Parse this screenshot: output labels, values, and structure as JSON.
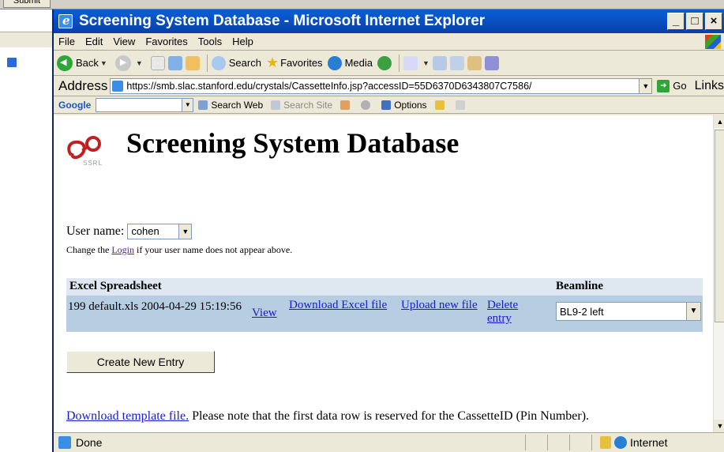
{
  "background": {
    "submit_label": "Submit"
  },
  "window": {
    "title": "Screening System Database - Microsoft Internet Explorer",
    "minimize": "_",
    "maximize": "□",
    "close": "×"
  },
  "menu": [
    "File",
    "Edit",
    "View",
    "Favorites",
    "Tools",
    "Help"
  ],
  "toolbar": {
    "back": "Back",
    "search": "Search",
    "favorites": "Favorites",
    "media": "Media"
  },
  "address": {
    "label": "Address",
    "url": "https://smb.slac.stanford.edu/crystals/CassetteInfo.jsp?accessID=55D6370D6343807C7586/",
    "go": "Go",
    "links": "Links"
  },
  "googlebar": {
    "logo": "Google",
    "search_web": "Search Web",
    "search_site": "Search Site",
    "options": "Options"
  },
  "page": {
    "logo_text": "SSRL",
    "title": "Screening System Database",
    "username_label": "User name:",
    "username_value": "cohen",
    "change_prefix": "Change the",
    "login_link": "Login",
    "change_suffix": "if your user name does not appear above.",
    "table": {
      "col_excel": "Excel Spreadsheet",
      "col_beamline": "Beamline",
      "row": {
        "file": "199 default.xls 2004-04-29 15:19:56",
        "view": "View",
        "download": "Download Excel file",
        "upload": "Upload new file",
        "delete": "Delete entry",
        "beamline": "BL9-2 left"
      }
    },
    "create_button": "Create New Entry",
    "template_link": "Download template file.",
    "template_note": "Please note that the first data row is reserved for the CassetteID (Pin Number)."
  },
  "status": {
    "text": "Done",
    "zone": "Internet"
  }
}
